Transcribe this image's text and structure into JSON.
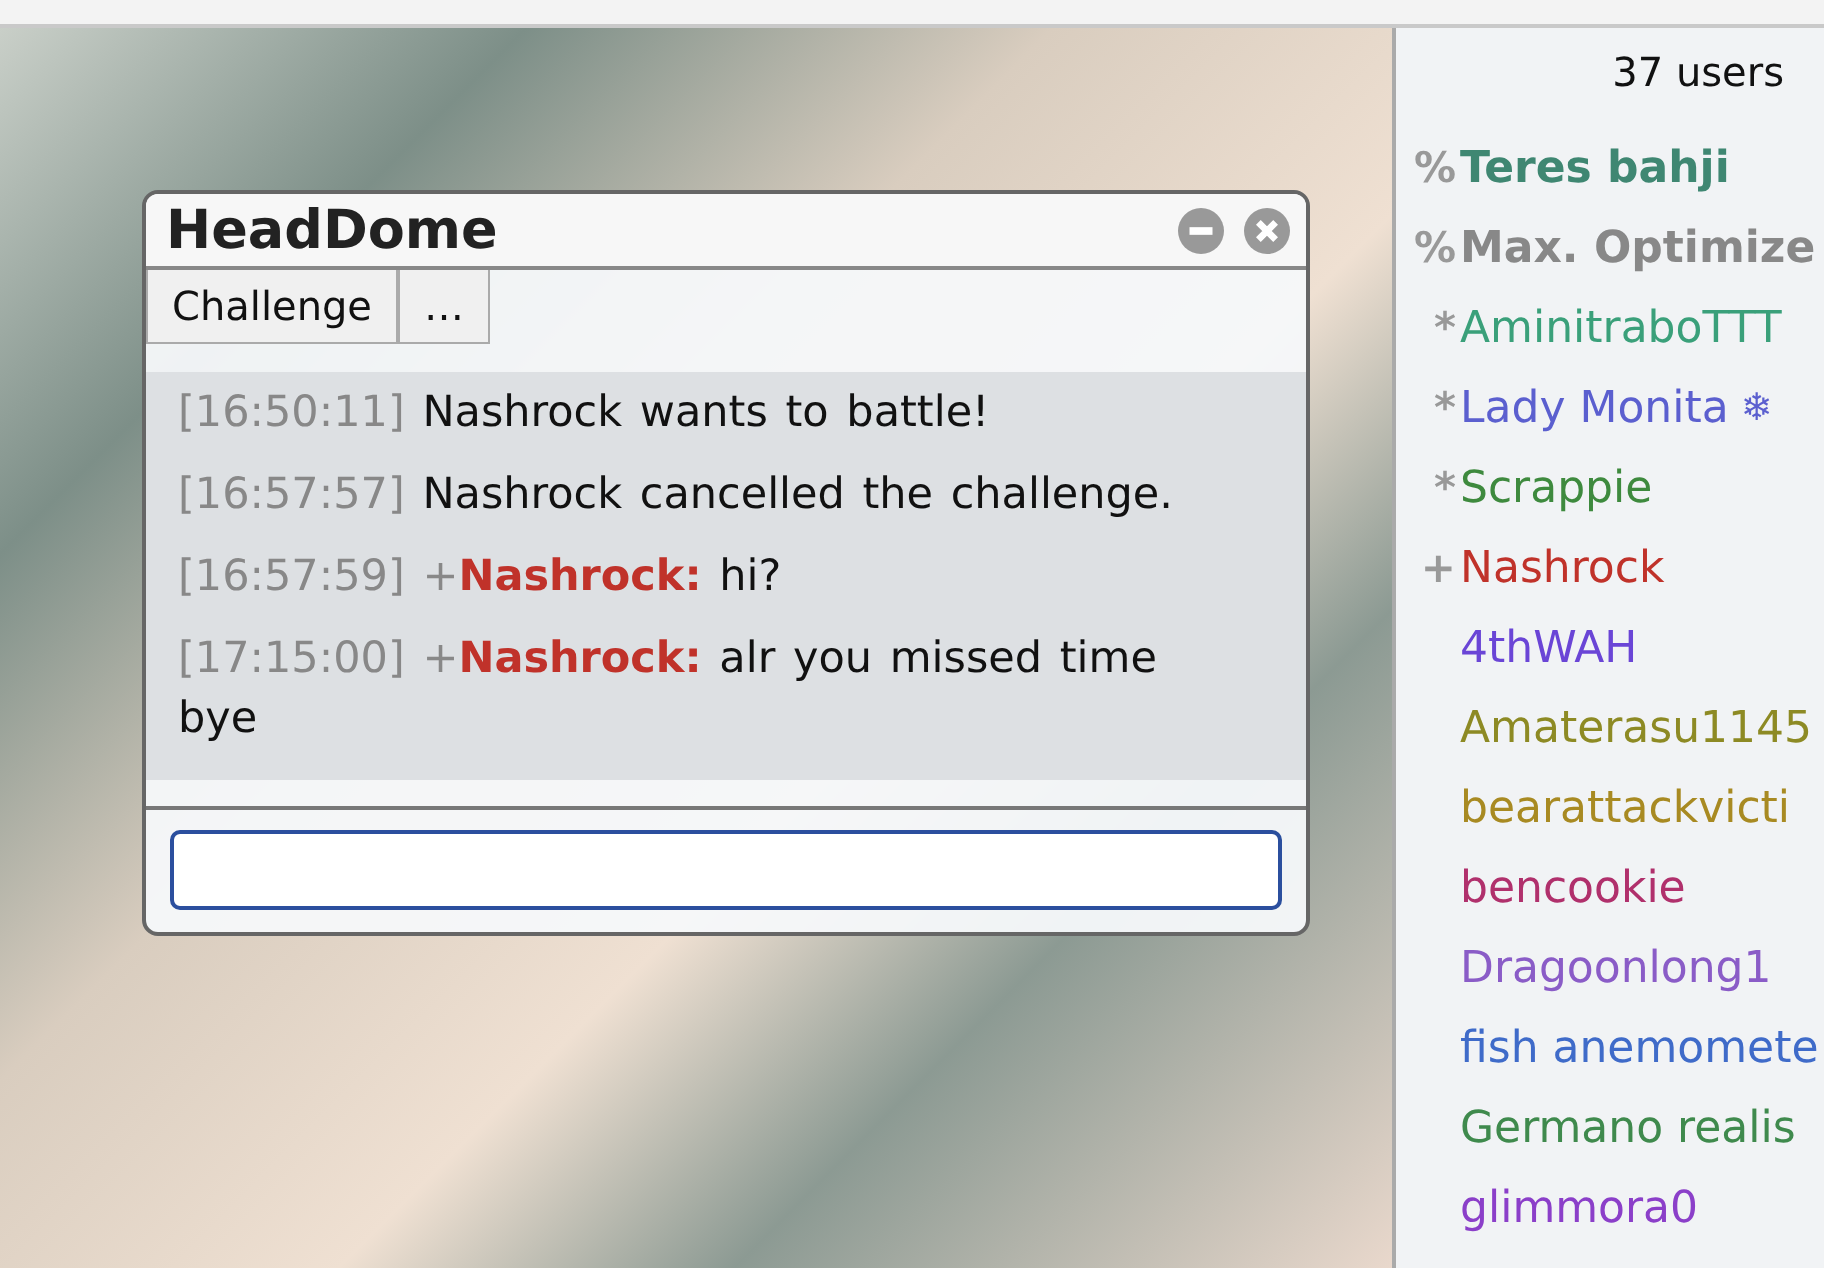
{
  "chat_window": {
    "title": "HeadDome",
    "toolbar": [
      "Challenge",
      "…"
    ],
    "messages": [
      {
        "kind": "system",
        "time": "[16:50:11]",
        "text": "Nashrock wants to battle!"
      },
      {
        "kind": "system",
        "time": "[16:57:57]",
        "text": "Nashrock cancelled the challenge."
      },
      {
        "kind": "chat",
        "time": "[16:57:59]",
        "rank": "+",
        "name": "Nashrock:",
        "color": "#c0322a",
        "text": "hi?"
      },
      {
        "kind": "chat",
        "time": "[17:15:00]",
        "rank": "+",
        "name": "Nashrock:",
        "color": "#c0322a",
        "text": "alr you missed time bye"
      }
    ]
  },
  "userlist": {
    "count": "37 users",
    "users": [
      {
        "rank": "%",
        "name": "Teres bahji",
        "color": "#3f8772",
        "bold": true
      },
      {
        "rank": "%",
        "name": "Max. Optimize",
        "color": "#888888",
        "bold": true
      },
      {
        "rank": "*",
        "name": "AminitraboTTT",
        "color": "#3aa07a",
        "bold": false
      },
      {
        "rank": "*",
        "name": "Lady Monita",
        "color": "#5b5fcf",
        "bold": false,
        "badge": "❄"
      },
      {
        "rank": "*",
        "name": "Scrappie",
        "color": "#3e8a3e",
        "bold": false
      },
      {
        "rank": "+",
        "name": "Nashrock",
        "color": "#c0322a",
        "bold": false
      },
      {
        "name": "4thWAH",
        "color": "#6a45d6",
        "bold": false
      },
      {
        "name": "Amaterasu1145",
        "color": "#8d8a24",
        "bold": false
      },
      {
        "name": "bearattackvicti",
        "color": "#a88a22",
        "bold": false
      },
      {
        "name": "bencookie",
        "color": "#b0306c",
        "bold": false
      },
      {
        "name": "Dragoonlong1",
        "color": "#8a5cc7",
        "bold": false
      },
      {
        "name": "fish anemomete",
        "color": "#3f6bc9",
        "bold": false
      },
      {
        "name": "Germano realis",
        "color": "#3f8a4d",
        "bold": false
      },
      {
        "name": "glimmora0",
        "color": "#8b3fc9",
        "bold": false
      }
    ]
  }
}
